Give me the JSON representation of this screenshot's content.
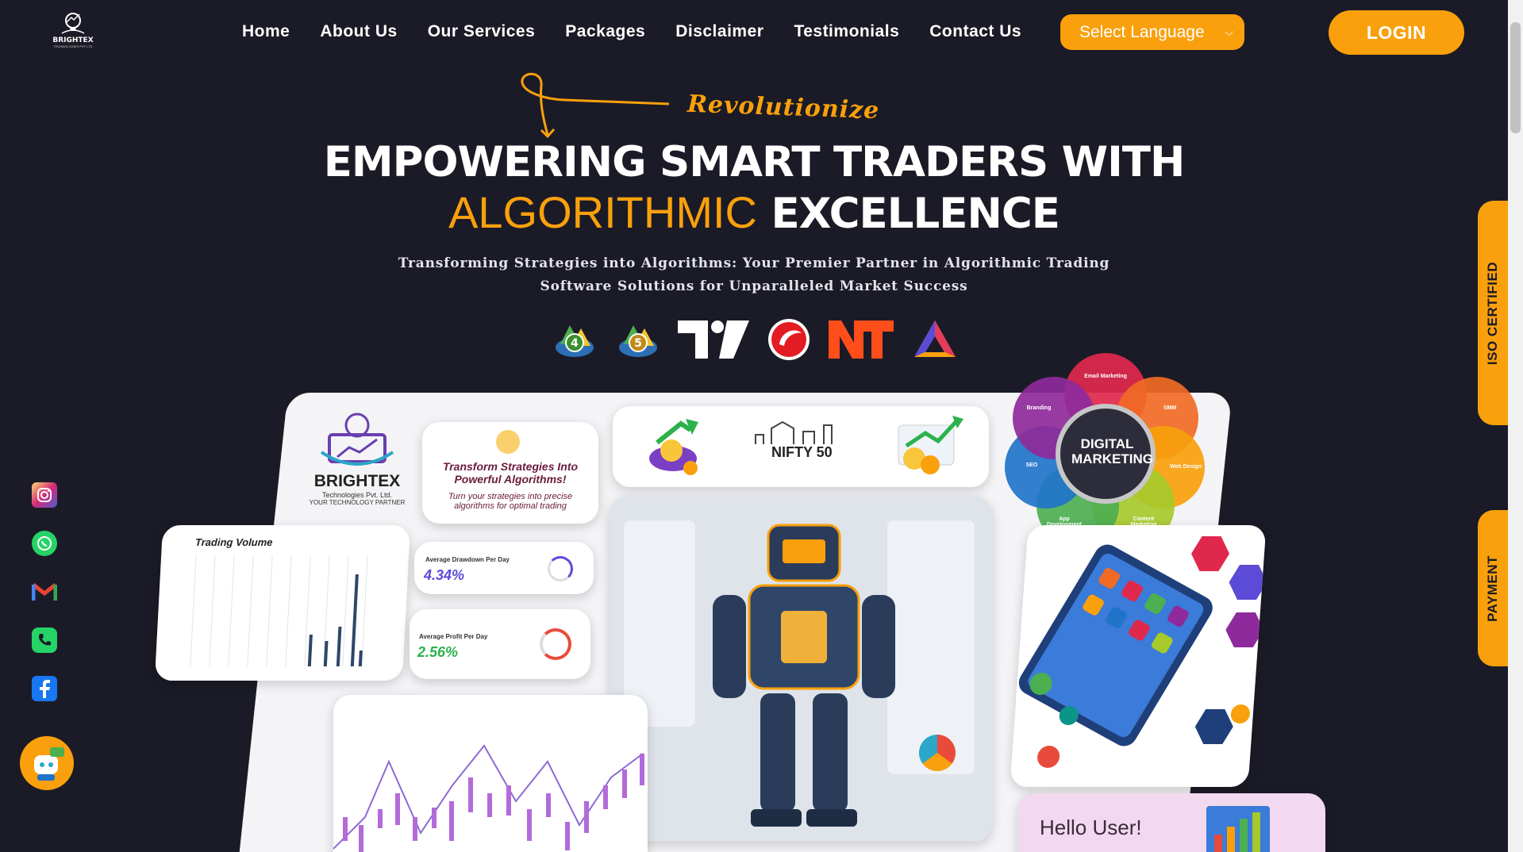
{
  "brand": {
    "logo_name": "BRIGHTEX",
    "logo_tagline": "TECHNOLOGIES PVT LTD"
  },
  "nav": {
    "items": [
      "Home",
      "About Us",
      "Our Services",
      "Packages",
      "Disclaimer",
      "Testimonials",
      "Contact Us"
    ]
  },
  "language_select": {
    "value": "Select Language"
  },
  "login_label": "LOGIN",
  "hero": {
    "script_word": "Revolutionize",
    "headline_line1": "EMPOWERING SMART TRADERS WITH",
    "headline_highlight": "ALGORITHMIC",
    "headline_rest": "EXCELLENCE",
    "subheading": "Transforming Strategies into Algorithms: Your Premier Partner in Algorithmic Trading Software Solutions for Unparalleled Market Success"
  },
  "platforms": [
    "MT4",
    "MT5",
    "TradingView",
    "AmiBroker",
    "NinjaTrader",
    "Multicharts"
  ],
  "collage": {
    "company_name": "BRIGHTEX",
    "company_sub": "Technologies Pvt. Ltd.",
    "company_tagline": "YOUR TECHNOLOGY PARTNER",
    "transform_title": "Transform Strategies Into Powerful Algorithms!",
    "transform_body": "Turn your strategies into precise algorithms for optimal trading",
    "nifty_label": "NIFTY 50",
    "trading_volume_title": "Trading Volume",
    "drawdown_label": "Average Drawdown Per Day",
    "drawdown_value": "4.34%",
    "profit_label": "Average Profit Per Day",
    "profit_value": "2.56%",
    "digital_marketing_title": "DIGITAL MARKETING",
    "digital_marketing_segments": [
      "Email Marketing",
      "SMM",
      "Web Design",
      "Content Marketing",
      "App Development",
      "SEO",
      "Branding"
    ],
    "hello_text": "Hello User!"
  },
  "social": [
    "instagram-icon",
    "whatsapp-icon",
    "gmail-icon",
    "phone-icon",
    "facebook-icon"
  ],
  "side_tabs": {
    "iso": "ISO CERTIFIED",
    "payment": "PAYMENT"
  },
  "colors": {
    "background": "#1b1b27",
    "accent": "#f9a00c"
  }
}
